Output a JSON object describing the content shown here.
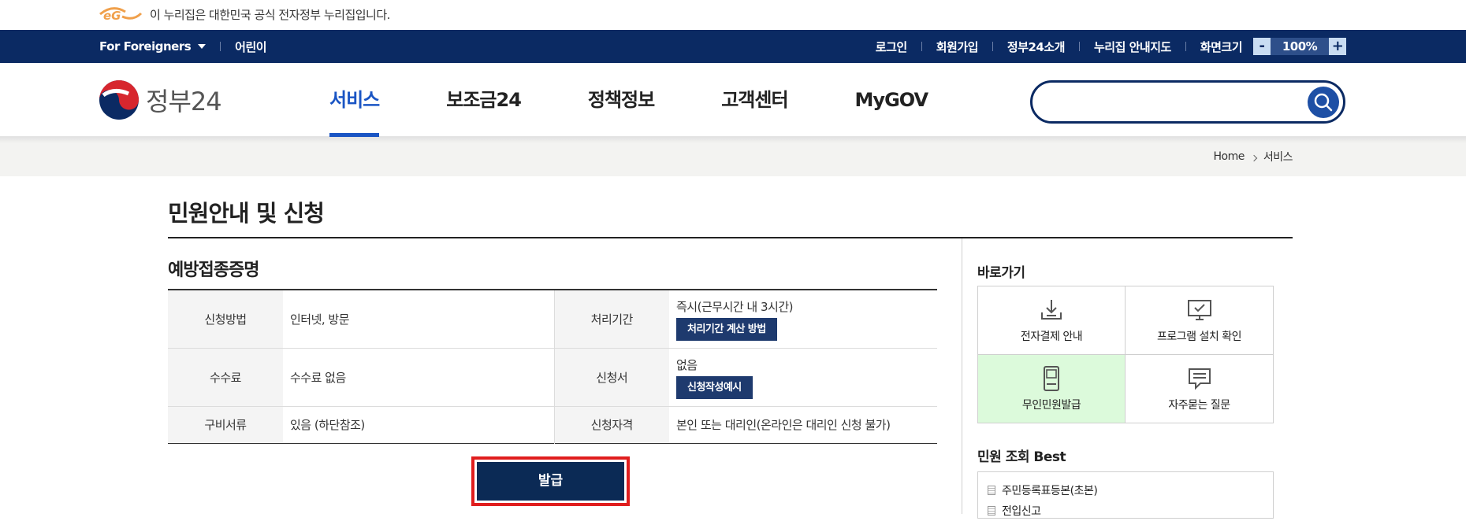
{
  "gov_banner": {
    "logo_icon": "eg-logo-icon",
    "text": "이 누리집은 대한민국 공식 전자정부 누리집입니다."
  },
  "util_bar": {
    "left": [
      "For Foreigners",
      "어린이"
    ],
    "right": [
      "로그인",
      "회원가입",
      "정부24소개",
      "누리집 안내지도",
      "화면크기"
    ],
    "zoom": {
      "minus": "-",
      "value": "100%",
      "plus": "+"
    }
  },
  "header": {
    "logo_text": "정부24",
    "nav": [
      "서비스",
      "보조금24",
      "정책정보",
      "고객센터",
      "MyGOV"
    ],
    "active_nav": "서비스",
    "search_placeholder": ""
  },
  "breadcrumb": [
    "Home",
    "서비스"
  ],
  "page": {
    "title": "민원안내 및 신청",
    "service_name": "예방접종증명",
    "rows": [
      {
        "label1": "신청방법",
        "value1": "인터넷, 방문",
        "label2": "처리기간",
        "value2": "즉시(근무시간 내 3시간)",
        "button": "처리기간 계산 방법"
      },
      {
        "label1": "수수료",
        "value1": "수수료 없음",
        "label2": "신청서",
        "value2": "없음",
        "button": "신청작성예시"
      },
      {
        "label1": "구비서류",
        "value1": "있음 (하단참조)",
        "label2": "신청자격",
        "value2": "본인 또는 대리인(온라인은 대리인 신청 불가)"
      }
    ],
    "issue_button": "발급"
  },
  "sidebar": {
    "quick_title": "바로가기",
    "quick_links": [
      {
        "label": "전자결제 안내",
        "icon": "download-icon"
      },
      {
        "label": "프로그램 설치 확인",
        "icon": "monitor-check-icon"
      },
      {
        "label": "무인민원발급",
        "icon": "kiosk-icon"
      },
      {
        "label": "자주묻는 질문",
        "icon": "chat-icon"
      }
    ],
    "best_title": "민원 조회 Best",
    "best_items": [
      "주민등록표등본(초본)",
      "전입신고"
    ]
  },
  "colors": {
    "navy": "#0b2a63",
    "active_blue": "#1a55c4",
    "highlight_green": "#dcfadb",
    "outline_red": "#e01e1e"
  }
}
